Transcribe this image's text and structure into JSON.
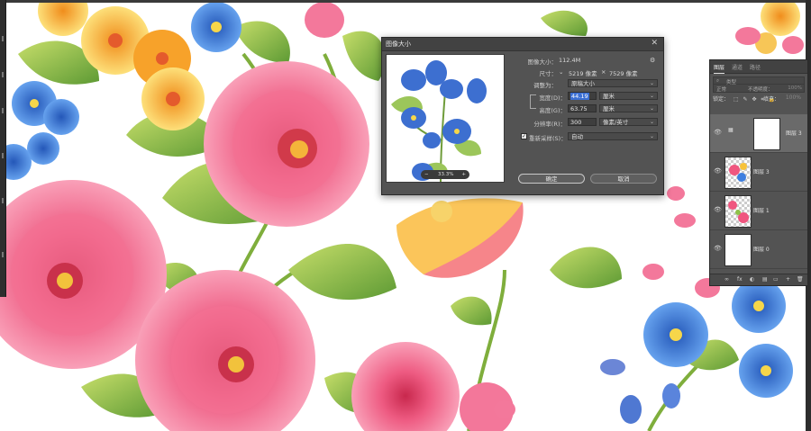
{
  "dialog": {
    "title": "图像大小",
    "close_icon": "close-icon",
    "image_size_label": "图像大小：",
    "image_size_value": "112.4M",
    "dimensions_label": "尺寸：",
    "dimensions_width": "5219 像素",
    "dimensions_sep": "×",
    "dimensions_height": "7529 像素",
    "fit_to_label": "调整为：",
    "fit_to_value": "原稿大小",
    "width_label": "宽度(D)：",
    "width_value": "44.19",
    "width_unit": "厘米",
    "height_label": "高度(G)：",
    "height_value": "63.75",
    "height_unit": "厘米",
    "resolution_label": "分辨率(R)：",
    "resolution_value": "300",
    "resolution_unit": "像素/英寸",
    "resample_label": "重新采样(S)：",
    "resample_checked": true,
    "resample_check_glyph": "✓",
    "resample_value": "自动",
    "ok_label": "确定",
    "cancel_label": "取消",
    "preview_zoom": "33.3%",
    "zoom_minus": "−",
    "zoom_plus": "+"
  },
  "layers_panel": {
    "tabs": [
      "图层",
      "通道",
      "路径"
    ],
    "search_placeholder": "类型",
    "blend_mode": "正常",
    "opacity_label": "不透明度：",
    "opacity_value": "100%",
    "lock_label": "锁定：",
    "fill_label": "填充：",
    "fill_value": "100%",
    "tool_icons": [
      "⬚",
      "✎",
      "✥",
      "⌗",
      "🔒"
    ],
    "layers": [
      {
        "name": "图层 3",
        "selected": true,
        "thumb": "mask"
      },
      {
        "name": "图层 3",
        "selected": false,
        "thumb": "flowers"
      },
      {
        "name": "图层 1",
        "selected": false,
        "thumb": "flowers"
      },
      {
        "name": "图层 0",
        "selected": false,
        "thumb": "white"
      }
    ],
    "footer_icons": [
      "∞",
      "fx",
      "◐",
      "▤",
      "▭",
      "+",
      "🗑"
    ]
  },
  "colors": {
    "dialog_bg": "#535353",
    "selection_highlight": "#3b6fd4",
    "pink_flower": "#f0567f",
    "blue_flower": "#3e7fe0",
    "yellow_flower": "#f7c23a",
    "leaf": "#8fc24a"
  }
}
